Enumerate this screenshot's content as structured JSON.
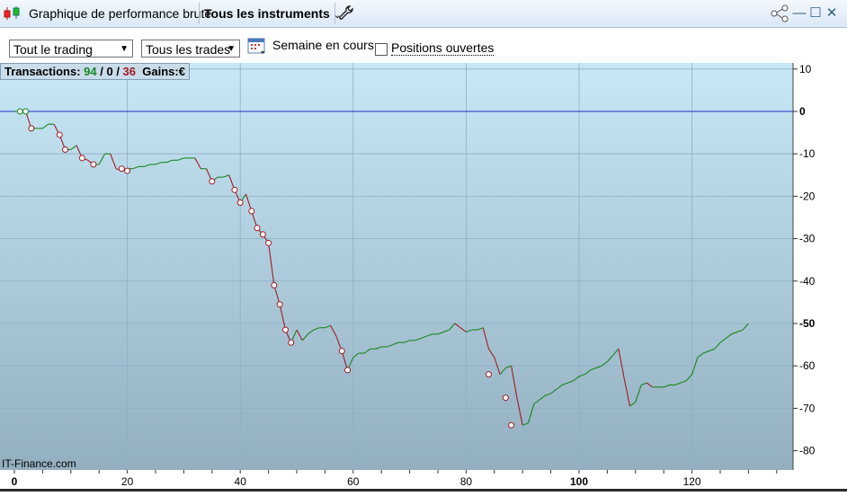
{
  "window": {
    "title": "Graphique de performance brute",
    "instruments_label": "Tous les instruments",
    "controls": [
      "minimize-icon",
      "maximize-icon",
      "close-icon"
    ]
  },
  "toolbar": {
    "trading_select": "Tout le trading",
    "trades_select": "Tous les trades",
    "period_label": "Semaine en cours",
    "open_positions_label": "Positions ouvertes",
    "open_positions_checked": false
  },
  "summary": {
    "transactions_label": "Transactions:",
    "wins": "94",
    "sep1": " / ",
    "neutral": "0",
    "sep2": " / ",
    "losses": "36",
    "gains_label": "Gains:",
    "currency": "€"
  },
  "watermark": "IT-Finance.com",
  "colors": {
    "gain": "#18861f",
    "loss": "#a01c24",
    "zero_line": "#1d2bc8"
  },
  "chart_data": {
    "type": "line",
    "x_ticks": [
      "0",
      "20",
      "40",
      "60",
      "80",
      "100",
      "120"
    ],
    "y_ticks": [
      "10",
      "0",
      "-10",
      "-20",
      "-30",
      "-40",
      "-50",
      "-60",
      "-70",
      "-80"
    ],
    "xlim": [
      0,
      137
    ],
    "ylim": [
      -85,
      11
    ],
    "grid": true,
    "x": [
      0,
      1,
      2,
      3,
      4,
      5,
      6,
      7,
      8,
      9,
      10,
      11,
      12,
      13,
      14,
      15,
      16,
      17,
      18,
      19,
      20,
      21,
      22,
      23,
      24,
      25,
      26,
      27,
      28,
      29,
      30,
      31,
      32,
      33,
      34,
      35,
      36,
      37,
      38,
      39,
      40,
      41,
      42,
      43,
      44,
      45,
      46,
      47,
      48,
      49,
      50,
      51,
      52,
      53,
      54,
      55,
      56,
      57,
      58,
      59,
      60,
      61,
      62,
      63,
      64,
      65,
      66,
      67,
      68,
      69,
      70,
      71,
      72,
      73,
      74,
      75,
      76,
      77,
      78,
      79,
      80,
      81,
      82,
      83,
      84,
      85,
      86,
      87,
      88,
      89,
      90,
      91,
      92,
      93,
      94,
      95,
      96,
      97,
      98,
      99,
      100,
      101,
      102,
      103,
      104,
      105,
      106,
      107,
      108,
      109,
      110,
      111,
      112,
      113,
      114,
      115,
      116,
      117,
      118,
      119,
      120,
      121,
      122,
      123,
      124,
      125,
      126,
      127,
      128,
      129,
      130
    ],
    "y": [
      0,
      0,
      0,
      -4,
      -4,
      -4,
      -3,
      -3,
      -5.5,
      -9,
      -9,
      -8,
      -11,
      -11.5,
      -12.5,
      -12.5,
      -10,
      -10,
      -13.5,
      -14,
      -13.5,
      -13.5,
      -13,
      -13,
      -12.5,
      -12.5,
      -12,
      -12,
      -11.5,
      -11.5,
      -11,
      -11,
      -11,
      -13.5,
      -13.5,
      -16.5,
      -15.5,
      -15.5,
      -15,
      -18.5,
      -21.5,
      -19.5,
      -23.5,
      -27.5,
      -29,
      -31,
      -41,
      -45.5,
      -51.5,
      -54.5,
      -51.5,
      -54,
      -52.5,
      -51.5,
      -51,
      -51,
      -50.5,
      -53,
      -56.5,
      -61,
      -58,
      -57,
      -57,
      -56,
      -56,
      -55.5,
      -55.5,
      -55,
      -54.5,
      -54.5,
      -54,
      -54,
      -53.5,
      -53,
      -52.5,
      -52.5,
      -52,
      -51.5,
      -50,
      -51,
      -52,
      -51.5,
      -51.5,
      -51,
      -56,
      -58,
      -62,
      -60.5,
      -60,
      -67.5,
      -74,
      -73.5,
      -69,
      -68,
      -67,
      -66.5,
      -65.5,
      -64.5,
      -64,
      -63.5,
      -62.5,
      -62,
      -61,
      -60.5,
      -60,
      -59,
      -57.5,
      -56,
      -63,
      -69.5,
      -68.5,
      -64.5,
      -64,
      -65,
      -65,
      -65,
      -64.5,
      -64.5,
      -64,
      -63.5,
      -62,
      -58,
      -57,
      -56.5,
      -56,
      -54.5,
      -53.5,
      -52.5,
      -52,
      -51.5,
      -50
    ],
    "loss_markers": [
      {
        "x": 1,
        "y": 0
      },
      {
        "x": 2,
        "y": 0
      },
      {
        "x": 3,
        "y": -4
      },
      {
        "x": 8,
        "y": -5.5
      },
      {
        "x": 9,
        "y": -9
      },
      {
        "x": 12,
        "y": -11
      },
      {
        "x": 14,
        "y": -12.5
      },
      {
        "x": 19,
        "y": -13.5
      },
      {
        "x": 20,
        "y": -14
      },
      {
        "x": 35,
        "y": -16.5
      },
      {
        "x": 39,
        "y": -18.5
      },
      {
        "x": 40,
        "y": -21.5
      },
      {
        "x": 42,
        "y": -23.5
      },
      {
        "x": 43,
        "y": -27.5
      },
      {
        "x": 44,
        "y": -29
      },
      {
        "x": 45,
        "y": -31
      },
      {
        "x": 46,
        "y": -41
      },
      {
        "x": 47,
        "y": -45.5
      },
      {
        "x": 48,
        "y": -51.5
      },
      {
        "x": 49,
        "y": -54.5
      },
      {
        "x": 58,
        "y": -56.5
      },
      {
        "x": 59,
        "y": -61
      },
      {
        "x": 84,
        "y": -62
      },
      {
        "x": 87,
        "y": -67.5
      },
      {
        "x": 88,
        "y": -74
      }
    ]
  }
}
